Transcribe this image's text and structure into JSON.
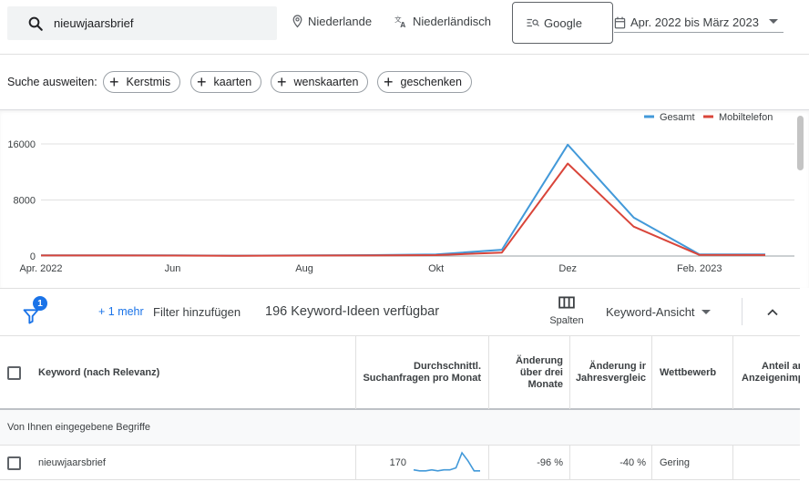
{
  "search": {
    "value": "nieuwjaarsbrief",
    "placeholder": ""
  },
  "location": {
    "label": "Niederlande",
    "icon": "location-pin-icon"
  },
  "language": {
    "label": "Niederländisch",
    "icon": "translate-icon"
  },
  "network": {
    "label": "Google",
    "icon": "search-network-icon"
  },
  "date_range": {
    "label": "Apr. 2022 bis März 2023",
    "icon": "calendar-icon"
  },
  "broaden": {
    "label": "Suche ausweiten:",
    "chips": [
      "Kerstmis",
      "kaarten",
      "wenskaarten",
      "geschenken"
    ]
  },
  "chart_data": {
    "type": "line",
    "x": [
      "Apr. 2022",
      "Mai",
      "Jun",
      "Jul",
      "Aug",
      "Sep",
      "Okt",
      "Nov",
      "Dez",
      "Jan",
      "Feb. 2023",
      "März"
    ],
    "xtick_labels": [
      "Apr. 2022",
      "Jun",
      "Aug",
      "Okt",
      "Dez",
      "Feb. 2023"
    ],
    "ytick_labels": [
      "16000",
      "8000",
      "0"
    ],
    "ylim": [
      0,
      16000
    ],
    "series": [
      {
        "name": "Gesamt",
        "color": "#4299d9",
        "values": [
          110,
          110,
          90,
          50,
          100,
          130,
          220,
          900,
          15900,
          5500,
          240,
          220
        ]
      },
      {
        "name": "Mobiltelefon",
        "color": "#d9453a",
        "values": [
          80,
          80,
          60,
          30,
          60,
          80,
          130,
          500,
          13200,
          4200,
          150,
          140
        ]
      }
    ],
    "legend_position": "top-right",
    "grid": true
  },
  "toolbar": {
    "filter_badge": "1",
    "more_label": "+ 1 mehr",
    "add_filter_label": "Filter hinzufügen",
    "ideas_count": "196 Keyword-Ideen verfügbar",
    "columns_label": "Spalten",
    "view_label": "Keyword-Ansicht"
  },
  "table": {
    "headers": {
      "keyword": "Keyword (nach Relevanz)",
      "avg_searches": [
        "Durchschnittl.",
        "Suchanfragen pro Monat"
      ],
      "three_month_change": [
        "Änderung",
        "über drei",
        "Monate"
      ],
      "yoy_change": [
        "Änderung ir",
        "Jahresvergleic"
      ],
      "competition": "Wettbewerb",
      "ad_share": [
        "Anteil an",
        "Anzeigenimp"
      ]
    },
    "group_label": "Von Ihnen eingegebene Begriffe",
    "rows": [
      {
        "keyword": "nieuwjaarsbrief",
        "avg_searches": "170",
        "trend": [
          3,
          2,
          2,
          3,
          2,
          3,
          3,
          5,
          20,
          12,
          2,
          2
        ],
        "three_month_change": "-96 %",
        "yoy_change": "-40 %",
        "competition": "Gering",
        "ad_share": ""
      }
    ]
  }
}
